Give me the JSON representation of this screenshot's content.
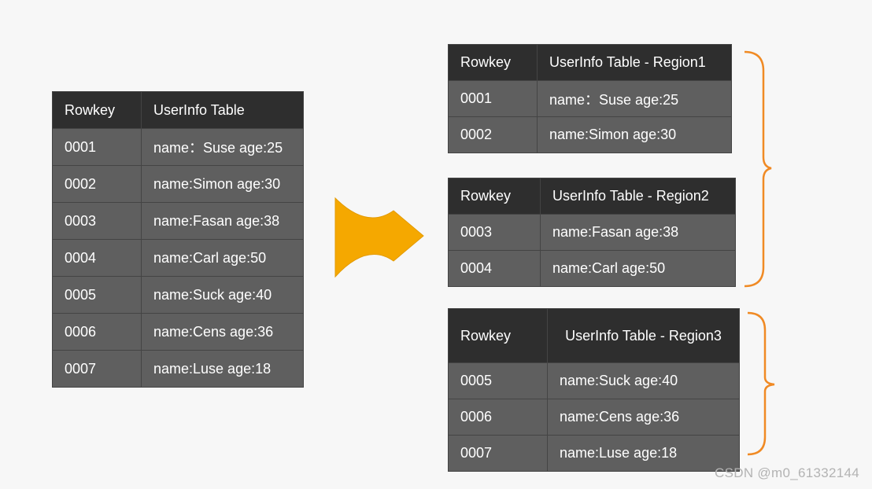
{
  "source_table": {
    "headers": [
      "Rowkey",
      "UserInfo Table"
    ],
    "rows": [
      [
        "0001",
        "name：Suse age:25"
      ],
      [
        "0002",
        "name:Simon age:30"
      ],
      [
        "0003",
        "name:Fasan age:38"
      ],
      [
        "0004",
        "name:Carl age:50"
      ],
      [
        "0005",
        "name:Suck age:40"
      ],
      [
        "0006",
        "name:Cens age:36"
      ],
      [
        "0007",
        "name:Luse age:18"
      ]
    ]
  },
  "regions": [
    {
      "headers": [
        "Rowkey",
        "UserInfo Table - Region1"
      ],
      "rows": [
        [
          "0001",
          "name：Suse age:25"
        ],
        [
          "0002",
          "name:Simon age:30"
        ]
      ]
    },
    {
      "headers": [
        "Rowkey",
        "UserInfo Table - Region2"
      ],
      "rows": [
        [
          "0003",
          "name:Fasan age:38"
        ],
        [
          "0004",
          "name:Carl age:50"
        ]
      ]
    },
    {
      "headers": [
        "Rowkey",
        "UserInfo Table - Region3"
      ],
      "rows": [
        [
          "0005",
          "name:Suck age:40"
        ],
        [
          "0006",
          "name:Cens age:36"
        ],
        [
          "0007",
          "name:Luse age:18"
        ]
      ]
    }
  ],
  "colors": {
    "background": "#f7f7f7",
    "header_bg": "#2e2e2e",
    "cell_bg": "#5f5f5f",
    "arrow": "#f5a800",
    "brace": "#f08a24"
  },
  "watermark": "CSDN @m0_61332144"
}
